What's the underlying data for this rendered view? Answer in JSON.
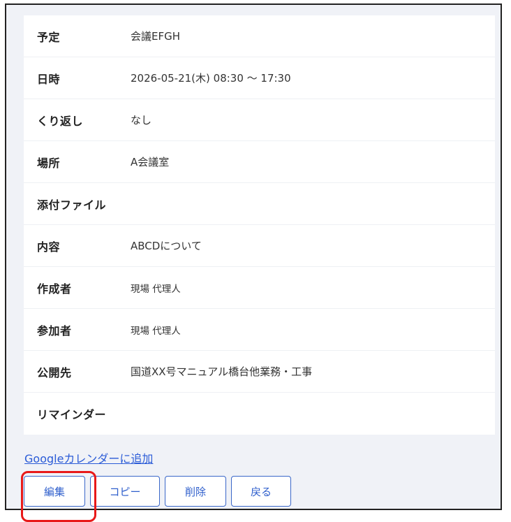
{
  "details": [
    {
      "label": "予定",
      "value": "会議EFGH"
    },
    {
      "label": "日時",
      "value": "2026-05-21(木) 08:30 ～ 17:30"
    },
    {
      "label": "くり返し",
      "value": "なし"
    },
    {
      "label": "場所",
      "value": "A会議室"
    },
    {
      "label": "添付ファイル",
      "value": ""
    },
    {
      "label": "内容",
      "value": "ABCDについて"
    },
    {
      "label": "作成者",
      "value": "現場 代理人"
    },
    {
      "label": "参加者",
      "value": "現場 代理人"
    },
    {
      "label": "公開先",
      "value": "国道XX号マニュアル橋台他業務・工事"
    },
    {
      "label": "リマインダー",
      "value": ""
    }
  ],
  "links": {
    "google_calendar": "Googleカレンダーに追加"
  },
  "buttons": {
    "edit": "編集",
    "copy": "コピー",
    "delete": "削除",
    "back": "戻る"
  },
  "colors": {
    "accent": "#2f5fcc",
    "highlight": "#e81919",
    "background": "#f0f2f7"
  }
}
